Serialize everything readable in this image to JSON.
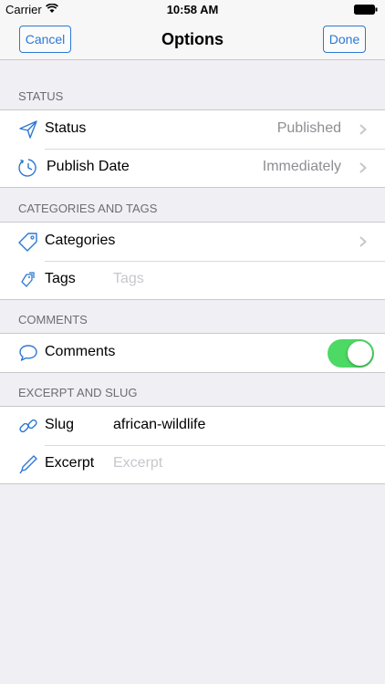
{
  "status_bar": {
    "carrier": "Carrier",
    "time": "10:58 AM"
  },
  "nav": {
    "cancel_label": "Cancel",
    "title": "Options",
    "done_label": "Done"
  },
  "sections": {
    "status": {
      "header": "STATUS",
      "status_label": "Status",
      "status_value": "Published",
      "publish_date_label": "Publish Date",
      "publish_date_value": "Immediately"
    },
    "categories_tags": {
      "header": "CATEGORIES AND TAGS",
      "categories_label": "Categories",
      "tags_label": "Tags",
      "tags_placeholder": "Tags"
    },
    "comments": {
      "header": "COMMENTS",
      "comments_label": "Comments",
      "comments_enabled": true
    },
    "excerpt_slug": {
      "header": "EXCERPT AND SLUG",
      "slug_label": "Slug",
      "slug_value": "african-wildlife",
      "excerpt_label": "Excerpt",
      "excerpt_placeholder": "Excerpt"
    }
  },
  "colors": {
    "accent": "#2b78d4",
    "toggle_on": "#4cd964",
    "background": "#efeff4"
  },
  "icons": [
    "paper-plane-icon",
    "clock-icon",
    "tag-icon",
    "tags-icon",
    "speech-bubble-icon",
    "link-icon",
    "pen-icon",
    "chevron-right-icon",
    "wifi-icon",
    "battery-icon"
  ]
}
